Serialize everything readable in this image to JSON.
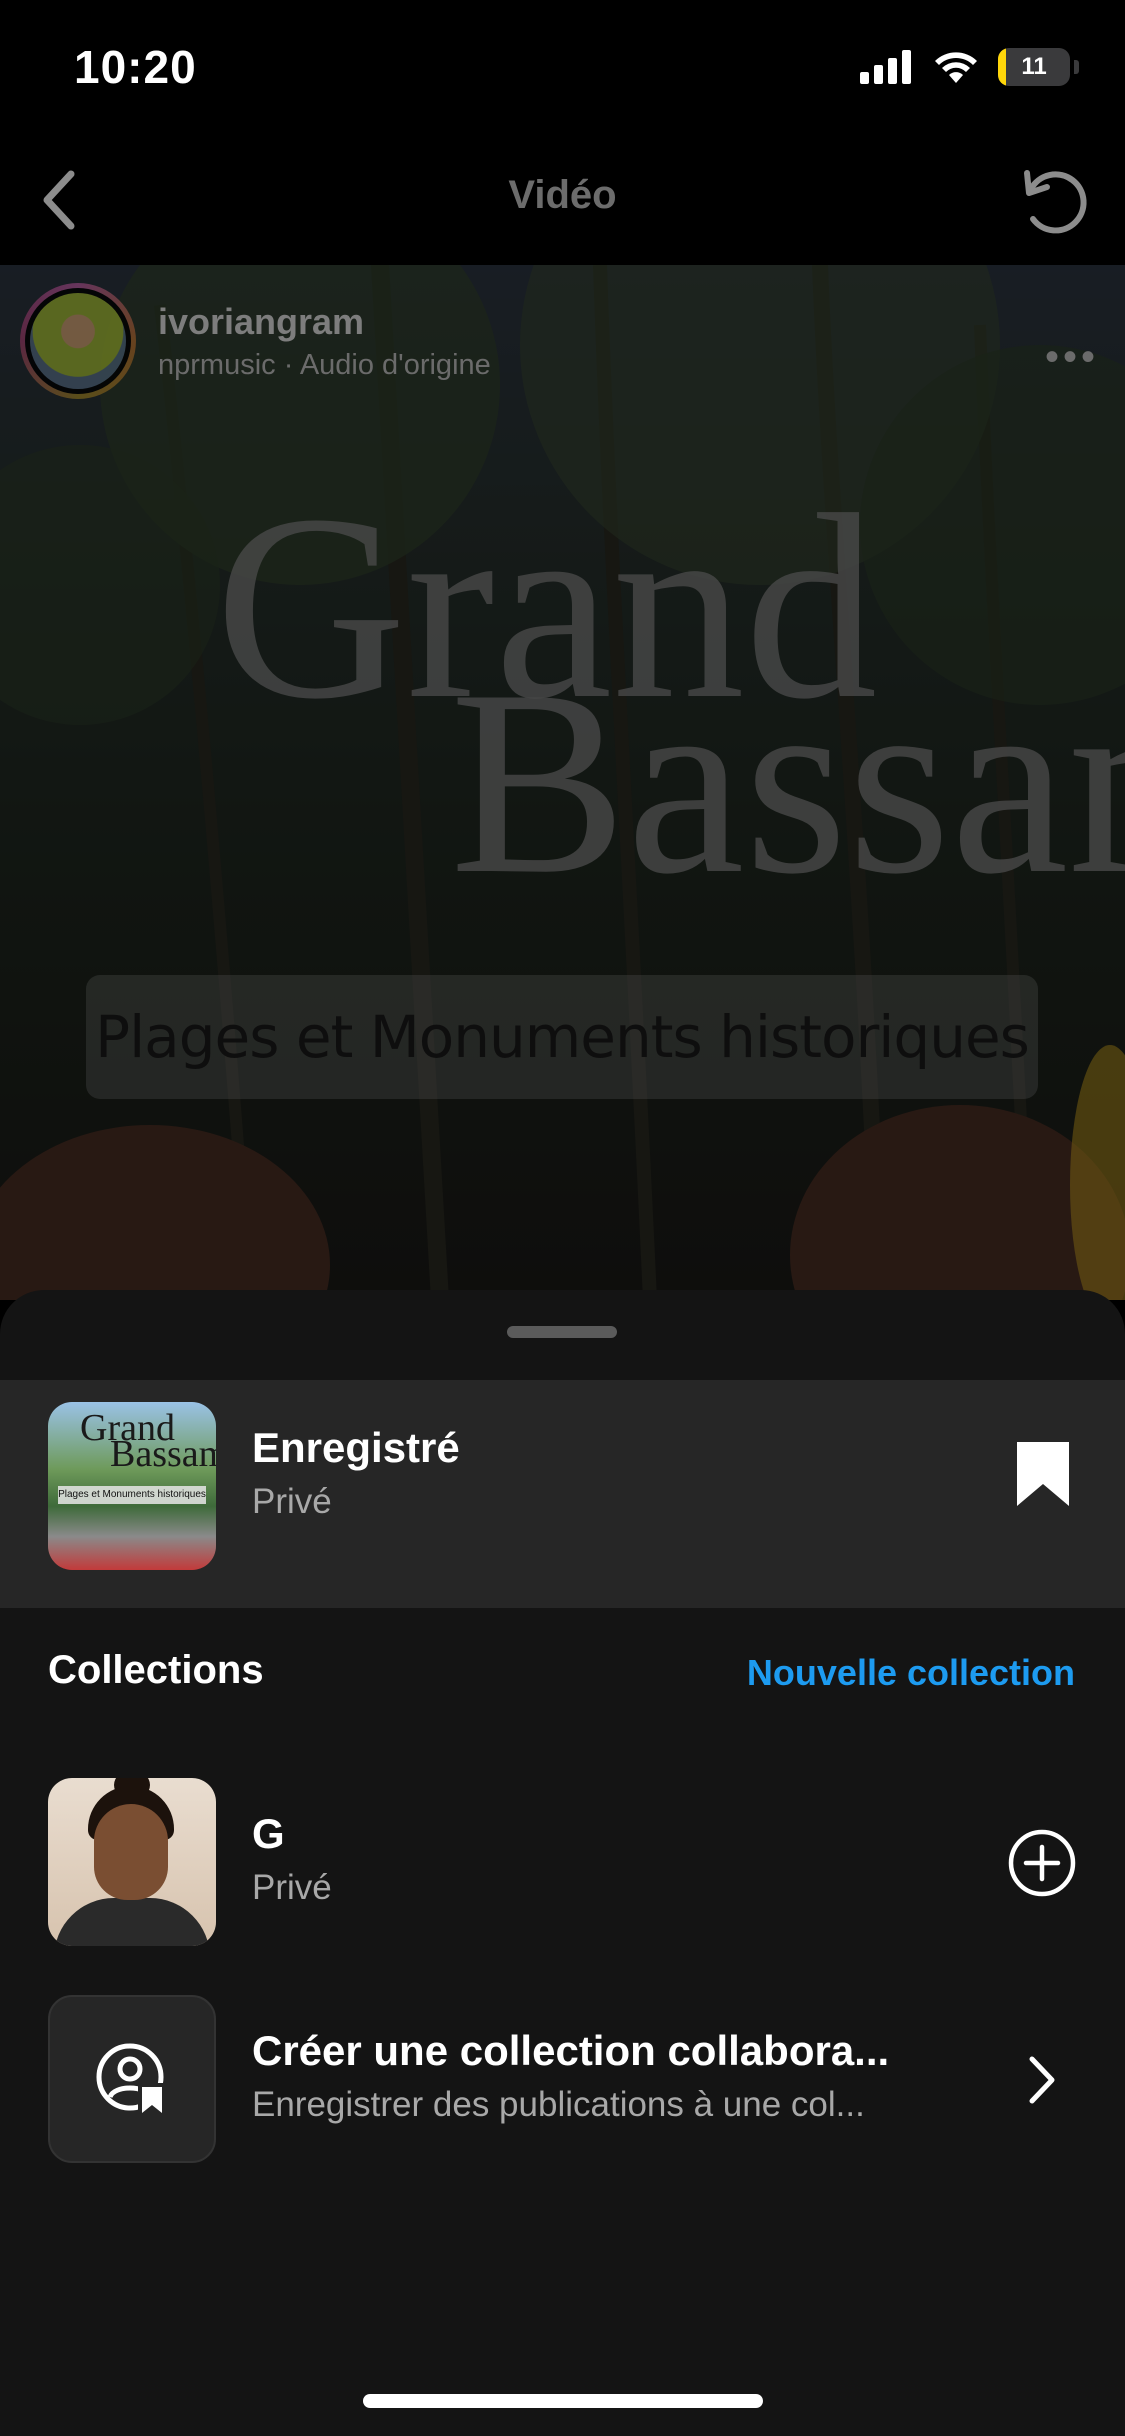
{
  "status_bar": {
    "time": "10:20",
    "battery_level": "11",
    "battery_fraction": 0.11,
    "icons": [
      "signal-icon",
      "wifi-icon",
      "battery-icon"
    ]
  },
  "nav": {
    "title": "Vidéo",
    "back_icon": "chevron-left-icon",
    "refresh_icon": "refresh-icon"
  },
  "post": {
    "username": "ivoriangram",
    "audio": "nprmusic · Audio d'origine",
    "more_icon": "more-horizontal-icon",
    "video_title_line1": "Grand",
    "video_title_line2": "Bassam",
    "video_caption": "Plages et Monuments historiques"
  },
  "sheet": {
    "saved": {
      "title": "Enregistré",
      "subtitle": "Privé",
      "icon": "bookmark-filled-icon",
      "thumb_line1": "Grand",
      "thumb_line2": "Bassam",
      "thumb_caption": "Plages et Monuments historiques"
    },
    "collections_label": "Collections",
    "new_collection_label": "Nouvelle collection",
    "collections": [
      {
        "title": "G",
        "subtitle": "Privé",
        "action_icon": "plus-circle-icon"
      },
      {
        "title": "Créer une collection collabora...",
        "subtitle": "Enregistrer des publications à une col...",
        "action_icon": "chevron-right-icon",
        "thumb_icon": "collaborative-bookmark-icon"
      }
    ]
  },
  "colors": {
    "background": "#000000",
    "sheet": "#141414",
    "saved_row": "#262626",
    "accent": "#1d9bf0",
    "secondary_text": "#a8a8a8",
    "battery": "#ffd60a"
  }
}
